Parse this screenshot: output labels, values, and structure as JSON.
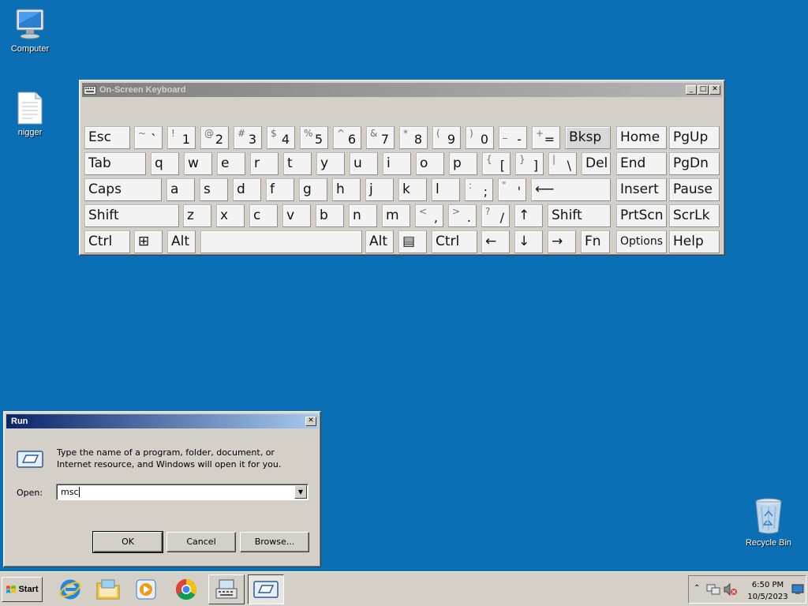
{
  "desktop": {
    "icons": [
      {
        "label": "Computer"
      },
      {
        "label": "nigger"
      },
      {
        "label": "Recycle Bin"
      }
    ]
  },
  "osk": {
    "title": "On-Screen Keyboard",
    "rows": [
      [
        {
          "main": "Esc"
        },
        {
          "top": "~",
          "bot": "`"
        },
        {
          "top": "!",
          "bot": "1"
        },
        {
          "top": "@",
          "bot": "2"
        },
        {
          "top": "#",
          "bot": "3"
        },
        {
          "top": "$",
          "bot": "4"
        },
        {
          "top": "%",
          "bot": "5"
        },
        {
          "top": "^",
          "bot": "6"
        },
        {
          "top": "&",
          "bot": "7"
        },
        {
          "top": "*",
          "bot": "8"
        },
        {
          "top": "(",
          "bot": "9"
        },
        {
          "top": ")",
          "bot": "0"
        },
        {
          "top": "_",
          "bot": "-"
        },
        {
          "top": "+",
          "bot": "="
        },
        {
          "main": "Bksp"
        },
        {
          "main": "Home"
        },
        {
          "main": "PgUp"
        }
      ],
      [
        {
          "main": "Tab"
        },
        {
          "main": "q"
        },
        {
          "main": "w"
        },
        {
          "main": "e"
        },
        {
          "main": "r"
        },
        {
          "main": "t"
        },
        {
          "main": "y"
        },
        {
          "main": "u"
        },
        {
          "main": "i"
        },
        {
          "main": "o"
        },
        {
          "main": "p"
        },
        {
          "top": "{",
          "bot": "["
        },
        {
          "top": "}",
          "bot": "]"
        },
        {
          "top": "|",
          "bot": "\\"
        },
        {
          "main": "Del"
        },
        {
          "main": "End"
        },
        {
          "main": "PgDn"
        }
      ],
      [
        {
          "main": "Caps"
        },
        {
          "main": "a"
        },
        {
          "main": "s"
        },
        {
          "main": "d"
        },
        {
          "main": "f"
        },
        {
          "main": "g"
        },
        {
          "main": "h"
        },
        {
          "main": "j"
        },
        {
          "main": "k"
        },
        {
          "main": "l"
        },
        {
          "top": ":",
          "bot": ";"
        },
        {
          "top": "\"",
          "bot": "'"
        },
        {
          "main": "⟵"
        },
        {
          "main": "Insert"
        },
        {
          "main": "Pause"
        }
      ],
      [
        {
          "main": "Shift"
        },
        {
          "main": "z"
        },
        {
          "main": "x"
        },
        {
          "main": "c"
        },
        {
          "main": "v"
        },
        {
          "main": "b"
        },
        {
          "main": "n"
        },
        {
          "main": "m"
        },
        {
          "top": "<",
          "bot": ","
        },
        {
          "top": ">",
          "bot": "."
        },
        {
          "top": "?",
          "bot": "/"
        },
        {
          "main": "↑"
        },
        {
          "main": "Shift"
        },
        {
          "main": "PrtScn"
        },
        {
          "main": "ScrLk"
        }
      ],
      [
        {
          "main": "Ctrl"
        },
        {
          "main": "⊞"
        },
        {
          "main": "Alt"
        },
        {
          "main": ""
        },
        {
          "main": "Alt"
        },
        {
          "main": "▤"
        },
        {
          "main": "Ctrl"
        },
        {
          "main": "←"
        },
        {
          "main": "↓"
        },
        {
          "main": "→"
        },
        {
          "main": "Fn"
        },
        {
          "main": "Options"
        },
        {
          "main": "Help"
        }
      ]
    ]
  },
  "run": {
    "title": "Run",
    "description": "Type the name of a program, folder, document, or Internet resource, and Windows will open it for you.",
    "open_label": "Open:",
    "open_value": "msc",
    "ok": "OK",
    "cancel": "Cancel",
    "browse": "Browse..."
  },
  "taskbar": {
    "start": "Start",
    "apps": [
      "internet-explorer-icon",
      "file-explorer-icon",
      "media-player-icon",
      "chrome-icon",
      "osk-icon",
      "run-icon"
    ],
    "clock_time": "6:50 PM",
    "clock_date": "10/5/2023"
  },
  "colors": {
    "desktop": "#0b6fb6",
    "run_title": "#0a246a",
    "osk_title": "#808080"
  }
}
